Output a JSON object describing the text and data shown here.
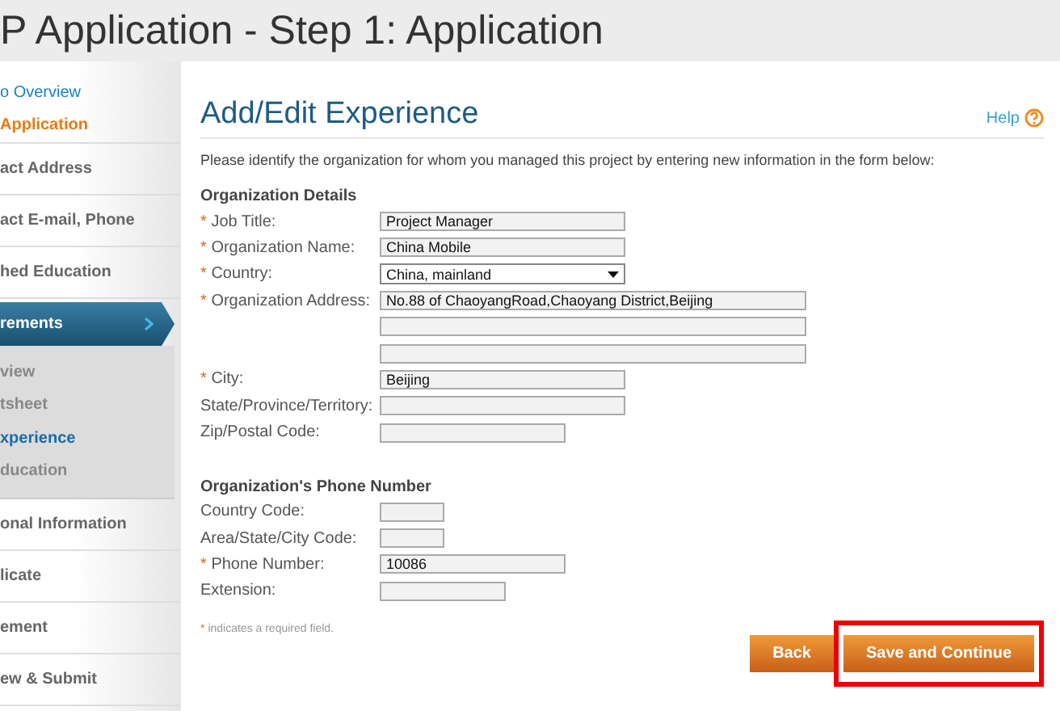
{
  "header": {
    "title": "P Application - Step 1: Application"
  },
  "sidebar": {
    "items": [
      {
        "label": "o Overview",
        "kind": "link"
      },
      {
        "label": "Application",
        "kind": "current"
      },
      {
        "label": "act Address",
        "kind": "section"
      },
      {
        "label": "act E-mail, Phone",
        "kind": "section"
      },
      {
        "label": "hed Education",
        "kind": "section"
      },
      {
        "label": "rements",
        "kind": "active"
      },
      {
        "label": "view",
        "kind": "sub",
        "selected": false
      },
      {
        "label": "tsheet",
        "kind": "sub",
        "selected": false
      },
      {
        "label": "xperience",
        "kind": "sub",
        "selected": true
      },
      {
        "label": "ducation",
        "kind": "sub",
        "selected": false
      },
      {
        "label": "onal Information",
        "kind": "section"
      },
      {
        "label": "licate",
        "kind": "section"
      },
      {
        "label": "ement",
        "kind": "section"
      },
      {
        "label": "ew & Submit",
        "kind": "section"
      }
    ]
  },
  "page": {
    "title": "Add/Edit Experience",
    "help": "Help",
    "intro": "Please identify the organization for whom you managed this project by entering new information in the form below:"
  },
  "sections": [
    {
      "heading": "Organization Details",
      "fields": [
        {
          "marker": "*",
          "label": "Job Title:",
          "kind": "text",
          "value": "Project Manager"
        },
        {
          "marker": "*",
          "label": "Organization Name:",
          "kind": "text",
          "value": "China Mobile"
        },
        {
          "marker": "*",
          "label": "Country:",
          "kind": "select",
          "value": "China, mainland"
        },
        {
          "marker": "*",
          "label": "Organization Address:",
          "kind": "text",
          "value": "No.88 of ChaoyangRoad,Chaoyang District,Beijing"
        },
        {
          "kind": "text"
        },
        {
          "kind": "text"
        },
        {
          "marker": "*",
          "label": "City:",
          "kind": "text",
          "value": "Beijing"
        },
        {
          "label": "State/Province/Territory:",
          "kind": "text"
        },
        {
          "label": "Zip/Postal Code:",
          "kind": "text"
        }
      ]
    },
    {
      "heading": "Organization's Phone Number",
      "fields": [
        {
          "label": "Country Code:",
          "kind": "text"
        },
        {
          "label": "Area/State/City Code:",
          "kind": "text"
        },
        {
          "marker": "*",
          "label": "Phone Number:",
          "kind": "text",
          "value": "10086"
        },
        {
          "label": "Extension:",
          "kind": "text"
        }
      ]
    }
  ],
  "note": {
    "marker": "*",
    "text": "indicates a required field."
  },
  "buttons": [
    {
      "label": "Back",
      "highlighted": false
    },
    {
      "label": "Save and Continue",
      "highlighted": true
    }
  ]
}
